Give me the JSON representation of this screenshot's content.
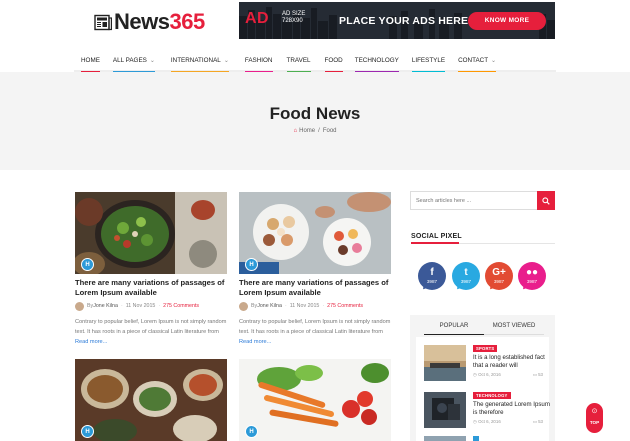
{
  "brand": {
    "name_prefix": "News",
    "name_number": "365"
  },
  "ad": {
    "badge": "AD",
    "size_line1": "AD SIZE",
    "size_line2": "728X90",
    "text": "PLACE YOUR ADS HERE",
    "button": "KNOW MORE"
  },
  "nav": {
    "items": [
      {
        "label": "HOME",
        "dropdown": false,
        "color": "#e61f3c"
      },
      {
        "label": "ALL PAGES",
        "dropdown": true,
        "color": "#2c9ad8"
      },
      {
        "label": "INTERNATIONAL",
        "dropdown": true,
        "color": "#f5a623"
      },
      {
        "label": "FASHION",
        "dropdown": false,
        "color": "#e91e8c"
      },
      {
        "label": "TRAVEL",
        "dropdown": false,
        "color": "#4caf50"
      },
      {
        "label": "FOOD",
        "dropdown": false,
        "color": "#e61f3c"
      },
      {
        "label": "TECHNOLOGY",
        "dropdown": false,
        "color": "#9c27b0"
      },
      {
        "label": "LIFESTYLE",
        "dropdown": false,
        "color": "#00bcd4"
      },
      {
        "label": "CONTACT",
        "dropdown": true,
        "color": "#ff9800"
      }
    ]
  },
  "page": {
    "title": "Food News",
    "breadcrumb_home": "Home",
    "breadcrumb_sep": "/",
    "breadcrumb_current": "Food"
  },
  "articles": [
    {
      "badge": "H",
      "title": "There are many variations of passages of Lorem Ipsum available",
      "by": "By",
      "author": "Jone Kilna",
      "date": "11 Nov 2015",
      "comments": "275 Comments",
      "excerpt": "Contrary to popular belief, Lorem Ipsum is not simply random text. It has roots in a piece of classical Latin literature from",
      "read_more": "Read more..."
    },
    {
      "badge": "H",
      "title": "There are many variations of passages of Lorem Ipsum available",
      "by": "By",
      "author": "Jone Kilna",
      "date": "11 Nov 2015",
      "comments": "275 Comments",
      "excerpt": "Contrary to popular belief, Lorem Ipsum is not simply random text. It has roots in a piece of classical Latin literature from",
      "read_more": "Read more..."
    },
    {
      "badge": "H"
    },
    {
      "badge": "H"
    }
  ],
  "sidebar": {
    "search_placeholder": "Search articles here ...",
    "social_heading": "SOCIAL PIXEL",
    "social": [
      {
        "icon": "facebook-icon",
        "glyph": "f",
        "count": "3987",
        "color": "#3b5998"
      },
      {
        "icon": "twitter-icon",
        "glyph": "t",
        "count": "3987",
        "color": "#29a9e1"
      },
      {
        "icon": "google-plus-icon",
        "glyph": "G+",
        "count": "3987",
        "color": "#e24b33"
      },
      {
        "icon": "flickr-icon",
        "glyph": "●●",
        "count": "3987",
        "color": "#e91e8c"
      }
    ],
    "tabs": {
      "popular": "POPULAR",
      "most_viewed": "MOST VIEWED"
    },
    "popular": [
      {
        "tag": "SPORTS",
        "title": "It is a long established fact that a reader will",
        "date": "Oct 6, 2016",
        "comments": "53"
      },
      {
        "tag": "TECHNOLOGY",
        "title": "The generated Lorem Ipsum is therefore",
        "date": "Oct 6, 2016",
        "comments": "53"
      },
      {
        "tag": "",
        "title": "",
        "date": "",
        "comments": ""
      }
    ]
  },
  "back_to_top": {
    "label": "TOP"
  }
}
